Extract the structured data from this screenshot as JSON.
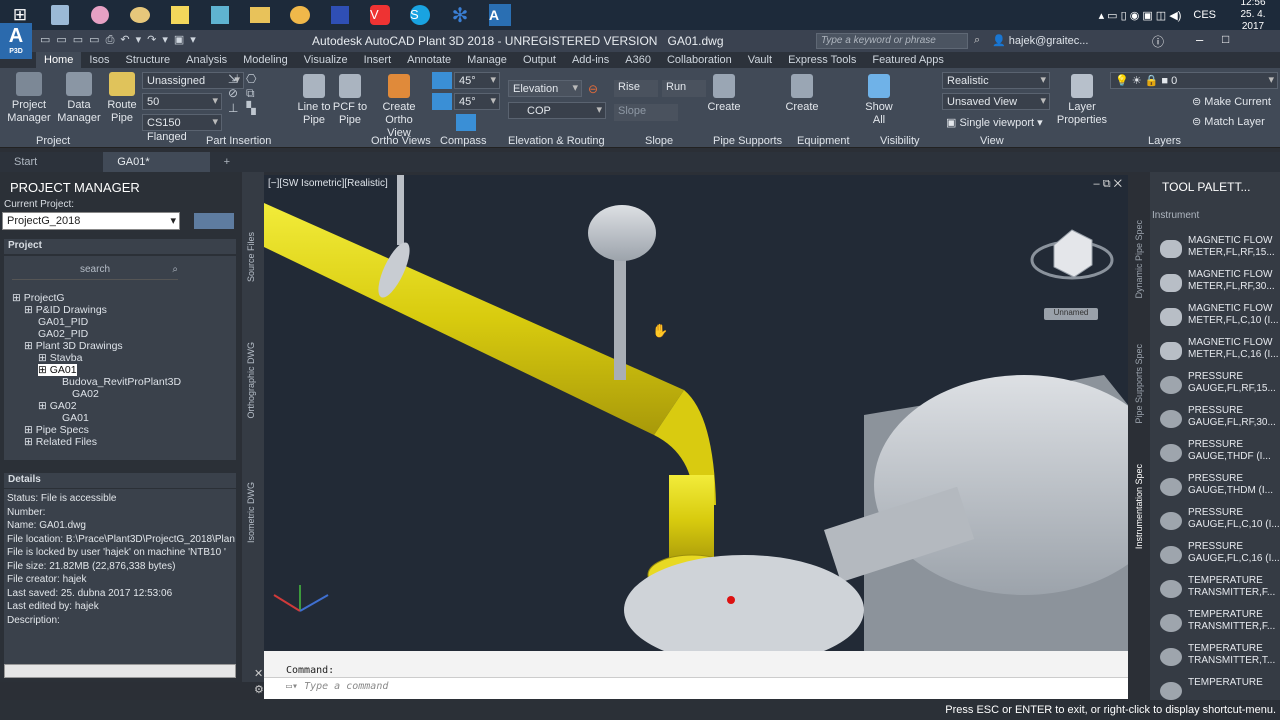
{
  "taskbar": {
    "clock_time": "12:56",
    "clock_date": "25. 4. 2017",
    "lang": "CES"
  },
  "title": {
    "app_title": "Autodesk AutoCAD Plant 3D 2018 - UNREGISTERED VERSION",
    "file": "GA01.dwg",
    "search_placeholder": "Type a keyword or phrase",
    "user": "hajek@graitec...",
    "app_letter": "A",
    "app_sub": "P3D"
  },
  "ribbon_tabs": [
    "Home",
    "Isos",
    "Structure",
    "Analysis",
    "Modeling",
    "Visualize",
    "Insert",
    "Annotate",
    "Manage",
    "Output",
    "Add-ins",
    "A360",
    "Collaboration",
    "Vault",
    "Express Tools",
    "Featured Apps"
  ],
  "ribbon": {
    "project_manager": "Project\nManager",
    "data_manager": "Data\nManager",
    "route_pipe": "Route\nPipe",
    "combo_unassigned": "Unassigned",
    "combo_size": "50",
    "combo_spec": "CS150 Flanged",
    "line_to_pipe": "Line to\nPipe",
    "pcf_to_pipe": "PCF to\nPipe",
    "create_ortho": "Create\nOrtho View",
    "angle1": "45°",
    "angle2": "45°",
    "elevation": "Elevation",
    "cop": "COP",
    "rise": "Rise",
    "run": "Run",
    "slope": "Slope",
    "create1": "Create",
    "create2": "Create",
    "show_all": "Show\nAll",
    "visual_style": "Realistic",
    "unsaved_view": "Unsaved View",
    "single_viewport": "Single viewport",
    "layer_properties": "Layer\nProperties",
    "layer_num": "0",
    "make_current": "Make Current",
    "match_layer": "Match Layer",
    "panels": [
      "Project",
      "Part Insertion",
      "Ortho Views",
      "Compass",
      "Elevation & Routing",
      "Slope",
      "Pipe Supports",
      "Equipment",
      "Visibility",
      "View",
      "Layers"
    ]
  },
  "doc_tabs": {
    "start": "Start",
    "current": "GA01*"
  },
  "pm": {
    "title": "PROJECT MANAGER",
    "current_label": "Current Project:",
    "current_project": "ProjectG_2018",
    "project_header": "Project",
    "search": "search",
    "tree": [
      "ProjectG",
      "P&ID Drawings",
      "GA01_PID",
      "GA02_PID",
      "Plant 3D Drawings",
      "Stavba",
      "GA01",
      "Budova_RevitProPlant3D",
      "GA02",
      "GA02",
      "GA01",
      "Pipe Specs",
      "Related Files"
    ],
    "side_tabs": [
      "Source Files",
      "Orthographic DWG",
      "Isometric DWG"
    ],
    "details_header": "Details",
    "details": [
      "Status: File is accessible",
      "Number:",
      "Name: GA01.dwg",
      "File location: B:\\Prace\\Plant3D\\ProjectG_2018\\Plan",
      "File is locked by user 'hajek' on machine 'NTB10 '",
      "File size: 21.82MB (22,876,338 bytes)",
      "File creator: hajek",
      "Last saved: 25. dubna 2017 12:53:06",
      "Last edited by: hajek",
      "Description:"
    ]
  },
  "viewport": {
    "label": "[−][SW Isometric][Realistic]",
    "viewcube_name": "Unnamed"
  },
  "command": {
    "label": "Command:",
    "placeholder": "Type a command"
  },
  "tool_palette": {
    "title": "TOOL PALETT...",
    "category": "Instrument",
    "side_tabs": [
      "Dynamic Pipe Spec",
      "Pipe Supports Spec",
      "Instrumentation Spec"
    ],
    "items": [
      "MAGNETIC FLOW METER,FL,RF,15...",
      "MAGNETIC FLOW METER,FL,RF,30...",
      "MAGNETIC FLOW METER,FL,C,10 (I...",
      "MAGNETIC FLOW METER,FL,C,16 (I...",
      "PRESSURE GAUGE,FL,RF,15...",
      "PRESSURE GAUGE,FL,RF,30...",
      "PRESSURE GAUGE,THDF (I...",
      "PRESSURE GAUGE,THDM (I...",
      "PRESSURE GAUGE,FL,C,10 (I...",
      "PRESSURE GAUGE,FL,C,16 (I...",
      "TEMPERATURE TRANSMITTER,F...",
      "TEMPERATURE TRANSMITTER,F...",
      "TEMPERATURE TRANSMITTER,T...",
      "TEMPERATURE"
    ]
  },
  "status": "Press ESC or ENTER to exit, or right-click to display shortcut-menu."
}
